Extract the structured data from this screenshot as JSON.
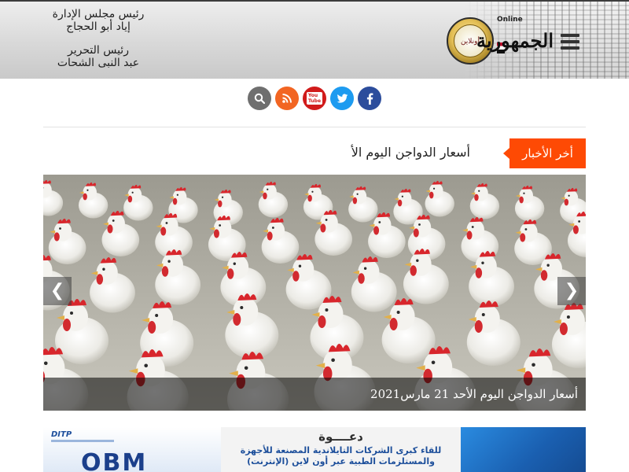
{
  "header": {
    "credits": {
      "chairman_title": "رئيس مجلس الإدارة",
      "chairman_name": "إياد أبو الحجاج",
      "editor_title": "رئيس التحرير",
      "editor_name": "عبد النبى الشحات"
    },
    "logo": {
      "name": "الجمهورية",
      "online": "Online",
      "seal_text": "أونلاين"
    },
    "menu_icon": "hamburger-icon"
  },
  "social": {
    "buttons": [
      {
        "name": "search",
        "icon": "search-icon",
        "glyph": "⚲",
        "color": "#6f6f6f"
      },
      {
        "name": "rss",
        "icon": "rss-icon",
        "glyph": "◉",
        "color": "#f26522"
      },
      {
        "name": "youtube",
        "icon": "youtube-icon",
        "glyph": "You Tube",
        "color": "#d11b1b"
      },
      {
        "name": "twitter",
        "icon": "twitter-icon",
        "glyph": "🐦",
        "color": "#1d9bf0"
      },
      {
        "name": "facebook",
        "icon": "facebook-icon",
        "glyph": "f",
        "color": "#2c4d9c"
      }
    ]
  },
  "ticker": {
    "label": "أخر الأخبار",
    "text": "أسعار الدواجن اليوم الأ"
  },
  "hero": {
    "caption": "أسعار الدواجن اليوم الأحد 21 مارس2021",
    "prev_glyph": "❮",
    "next_glyph": "❯"
  },
  "ad": {
    "brand": "DITP",
    "logo_text": "OBM",
    "title": "دعــــوة",
    "line1": "للقاء كبرى الشركات التايلاندية المصنعة للأجهزة",
    "line2": "والمستلزمات الطبية عبر أون لاين (الإنترنت)"
  },
  "colors": {
    "ticker_accent": "#fe4a04",
    "facebook": "#2c4d9c",
    "twitter": "#1d9bf0",
    "youtube": "#d11b1b",
    "rss": "#f26522"
  }
}
